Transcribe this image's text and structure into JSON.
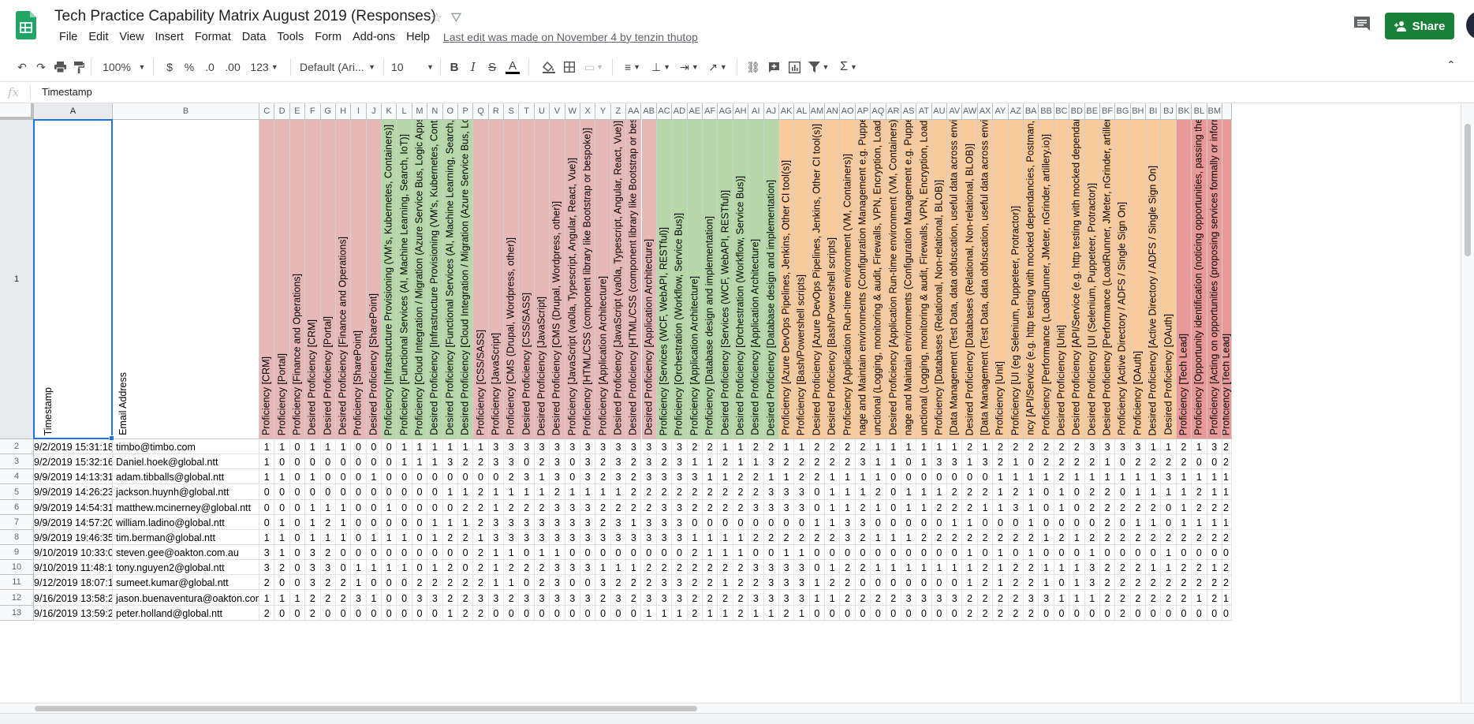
{
  "header": {
    "doc_title": "Tech Practice Capability Matrix August 2019 (Responses)",
    "last_edit": "Last edit was made on November 4 by tenzin thutop",
    "share_label": "Share",
    "menus": [
      "File",
      "Edit",
      "View",
      "Insert",
      "Format",
      "Data",
      "Tools",
      "Form",
      "Add-ons",
      "Help"
    ]
  },
  "toolbar": {
    "zoom": "100%",
    "currency": "$",
    "percent": "%",
    "dec_less": ".0",
    "dec_more": ".00",
    "more_formats": "123",
    "font": "Default (Ari...",
    "font_size": "10"
  },
  "formula_bar": {
    "fx": "fx",
    "value": "Timestamp"
  },
  "colors": {
    "red": "#e6b8b7",
    "green": "#b6d7a8",
    "orange": "#f9cb9c",
    "pink": "#ea9999",
    "accent": "#188038",
    "selection": "#1a73e8"
  },
  "sheet": {
    "columns": [
      {
        "letter": "A",
        "header": "Timestamp"
      },
      {
        "letter": "B",
        "header": "Email Address"
      },
      {
        "letter": "C",
        "header": "Proficiency [CRM]",
        "color": "red"
      },
      {
        "letter": "D",
        "header": "Proficiency [Portal]",
        "color": "red"
      },
      {
        "letter": "E",
        "header": "Proficiency [Finance and Operations]",
        "color": "red"
      },
      {
        "letter": "F",
        "header": "Desired  Proficiency [CRM]",
        "color": "red"
      },
      {
        "letter": "G",
        "header": "Desired  Proficiency [Portal]",
        "color": "red"
      },
      {
        "letter": "H",
        "header": "Desired  Proficiency [Finance and Operations]",
        "color": "red"
      },
      {
        "letter": "I",
        "header": "Proficiency [SharePoint]",
        "color": "red"
      },
      {
        "letter": "J",
        "header": "Desired  Proficiency [SharePoint]",
        "color": "red"
      },
      {
        "letter": "K",
        "header": "Proficiency [Infrastructure Provisioning (VM's, Kubernetes, Containers)]",
        "color": "green"
      },
      {
        "letter": "L",
        "header": "Proficiency [Functional Services (AI, Machine Learning, Search, IoT)]",
        "color": "green"
      },
      {
        "letter": "M",
        "header": "Proficiency [Cloud Integration / Migration (Azure Service Bus, Logic Apps)]",
        "color": "green"
      },
      {
        "letter": "N",
        "header": "Desired Proficiency [Infrastructure Provisioning (VM's, Kubernetes, Containers)]",
        "color": "green"
      },
      {
        "letter": "O",
        "header": "Desired Proficiency [Functional Services (AI, Machine Learning, Search, IoT)]",
        "color": "green"
      },
      {
        "letter": "P",
        "header": "Desired Proficiency [Cloud Integration / Migration (Azure Service Bus, Logic Apps)]",
        "color": "green"
      },
      {
        "letter": "Q",
        "header": "Proficiency [CSS/SASS]",
        "color": "red"
      },
      {
        "letter": "R",
        "header": "Proficiency [JavaScript]",
        "color": "red"
      },
      {
        "letter": "S",
        "header": "Proficiency [CMS (Drupal, Wordpress, other)]",
        "color": "red"
      },
      {
        "letter": "T",
        "header": "Desired  Proficiency [CSS/SASS]",
        "color": "red"
      },
      {
        "letter": "U",
        "header": "Desired  Proficiency [JavaScript]",
        "color": "red"
      },
      {
        "letter": "V",
        "header": "Desired  Proficiency [CMS (Drupal, Wordpress, other)]",
        "color": "red"
      },
      {
        "letter": "W",
        "header": "Proficiency [JavaScript (va0la, Typescript, Angular, React, Vue)]",
        "color": "red"
      },
      {
        "letter": "X",
        "header": "Proficiency [HTML/CSS (component library like Bootstrap or bespoke)]",
        "color": "red"
      },
      {
        "letter": "Y",
        "header": "Proficiency [Application Architecture]",
        "color": "red"
      },
      {
        "letter": "Z",
        "header": "Desired  Proficiency [JavaScript (va0la, Typescript, Angular, React, Vue)]",
        "color": "red"
      },
      {
        "letter": "AA",
        "header": "Desired  Proficiency [HTML/CSS (component library like Bootstrap or bespoke)]",
        "color": "red"
      },
      {
        "letter": "AB",
        "header": "Desired  Proficiency [Application Architecture]",
        "color": "red"
      },
      {
        "letter": "AC",
        "header": "Proficiency [Services (WCF, WebAPI, RESTful)]",
        "color": "green"
      },
      {
        "letter": "AD",
        "header": "Proficiency [Orchestration (Workflow, Service Bus)]",
        "color": "green"
      },
      {
        "letter": "AE",
        "header": "Proficiency [Application Architecture]",
        "color": "green"
      },
      {
        "letter": "AF",
        "header": "Proficiency [Database design and implementation]",
        "color": "green"
      },
      {
        "letter": "AG",
        "header": "Desired  Proficiency [Services (WCF, WebAPI, RESTful)]",
        "color": "green"
      },
      {
        "letter": "AH",
        "header": "Desired  Proficiency [Orchestration (Workflow, Service Bus)]",
        "color": "green"
      },
      {
        "letter": "AI",
        "header": "Desired  Proficiency [Application Architecture]",
        "color": "green"
      },
      {
        "letter": "AJ",
        "header": "Desired  Proficiency [Database design and implementation]",
        "color": "green"
      },
      {
        "letter": "AK",
        "header": "Proficiency [Azure DevOps Pipelines, Jenkins, Other CI tool(s)]",
        "color": "orange"
      },
      {
        "letter": "AL",
        "header": "Proficiency [Bash/Powershell scripts]",
        "color": "orange"
      },
      {
        "letter": "AM",
        "header": "Desired Proficiency [Azure DevOps Pipelines, Jenkins, Other CI tool(s)]",
        "color": "orange"
      },
      {
        "letter": "AN",
        "header": "Desired Proficiency [Bash/Powershell scripts]",
        "color": "orange"
      },
      {
        "letter": "AO",
        "header": "Proficiency [Application Run-time environment (VM, Containers)]",
        "color": "orange"
      },
      {
        "letter": "AP",
        "header": "nage and Maintain environments (Configuration Management e.g. Puppet, Ansible)]",
        "color": "orange"
      },
      {
        "letter": "AQ",
        "header": "unctional (Logging, monitoring & audit, Firewalls, VPN, Encryption, Load balancing)]",
        "color": "orange"
      },
      {
        "letter": "AR",
        "header": "Desired Proficiency [Application Run-time environment (VM, Containers)]",
        "color": "orange"
      },
      {
        "letter": "AS",
        "header": "nage and Maintain environments (Configuration Management e.g. Puppet, Ansible)]",
        "color": "orange"
      },
      {
        "letter": "AT",
        "header": "unctional (Logging, monitoring & audit, Firewalls, VPN, Encryption, Load balancing)]",
        "color": "orange"
      },
      {
        "letter": "AU",
        "header": "Proficiency [Databases  (Relational, Non-relational, BLOB)]",
        "color": "orange"
      },
      {
        "letter": "AV",
        "header": "[Data Management (Test Data, data obfuscation, useful data across environments)]",
        "color": "orange"
      },
      {
        "letter": "AW",
        "header": "Desired Proficiency [Databases  (Relational, Non-relational, BLOB)]",
        "color": "orange"
      },
      {
        "letter": "AX",
        "header": "[Data Management (Test Data, data obfuscation, useful data across environments)]",
        "color": "orange"
      },
      {
        "letter": "AY",
        "header": "Proficiency [Unit]",
        "color": "orange"
      },
      {
        "letter": "AZ",
        "header": "Proficiency [UI (eg Selenium, Puppeteer, Protractor)]",
        "color": "orange"
      },
      {
        "letter": "BA",
        "header": "ncy [API/Service (e.g. http testing with mocked dependancies, Postman, Insomnia)]",
        "color": "orange"
      },
      {
        "letter": "BB",
        "header": "Proficiency [Performance (LoadRunner, JMeter, nGrinder, artillery.io)]",
        "color": "orange"
      },
      {
        "letter": "BC",
        "header": "Desired Proficiency [Unit]",
        "color": "orange"
      },
      {
        "letter": "BD",
        "header": "Desired Proficiency [API/Service (e.g. http testing with mocked dependancies)]",
        "color": "orange"
      },
      {
        "letter": "BE",
        "header": "Desired Proficiency [UI (Selenium, Puppeteer, Protractor)]",
        "color": "orange"
      },
      {
        "letter": "BF",
        "header": "Desired Proficiency [Performance (LoadRunner, JMeter, nGrinder, artillery.io)]",
        "color": "orange"
      },
      {
        "letter": "BG",
        "header": "Proficiency [Active Directory / ADFS / Single Sign On]",
        "color": "orange"
      },
      {
        "letter": "BH",
        "header": "Proficiency [OAuth]",
        "color": "orange"
      },
      {
        "letter": "BI",
        "header": "Desired Proficiency [Active Directory / ADFS / Single Sign On]",
        "color": "orange"
      },
      {
        "letter": "BJ",
        "header": "Desired Proficiency [OAuth]",
        "color": "orange"
      },
      {
        "letter": "BK",
        "header": "Proficiency [Tech Lead]",
        "color": "pink"
      },
      {
        "letter": "BL",
        "header": "Proficiency [Opportunity identification (noticing opportunities, passing them on etc)]",
        "color": "pink"
      },
      {
        "letter": "BM",
        "header": "Proficiency [Acting on opportunities (proposing services formally or informally)]",
        "color": "pink"
      },
      {
        "letter": "",
        "header": "Proficiency [Tech Lead]",
        "color": "pink"
      }
    ],
    "rows": [
      {
        "n": "2",
        "ts": "9/2/2019 15:31:18",
        "email": "timbo@timbo.com",
        "v": "1 1 0 1 1 1 0 0 0 1 1 1 1 1 1 3 3 3 3 3 3 3 3 3 3 3 3 3 2 2 1 1 2 2 1 1 2 2 2 2 1 1 1 1 1 1 2 1 2 2 2 2 2 2 3 3 3 3 1 1 2 1 3 2 2 Ve"
      },
      {
        "n": "3",
        "ts": "9/2/2019 15:32:16",
        "email": "Daniel.hoek@global.ntt",
        "v": "1 0 0 0 0 0 0 0 0 1 1 1 3 2 2 3 3 0 2 3 0 3 2 3 2 3 2 3 1 1 2 1 1 3 2 2 2 2 2 3 1 1 0 1 3 3 1 3 2 1 0 2 2 2 2 1 0 2 2 2 2 0 0 2 1 2 2 Ve"
      },
      {
        "n": "4",
        "ts": "9/9/2019 14:13:31",
        "email": "adam.tibballs@global.ntt",
        "v": "1 1 0 1 0 0 0 1 0 0 0 0 0 0 0 0 2 3 1 3 0 3 2 3 2 3 3 3 3 1 1 2 2 1 1 2 2 1 1 1 1 0 0 0 0 0 0 0 1 1 1 1 2 1 1 1 1 1 1 3 1 1 1 1 1 1 1 2 So"
      },
      {
        "n": "5",
        "ts": "9/9/2019 14:26:23",
        "email": "jackson.huynh@global.ntt",
        "v": "0 0 0 0 0 0 0 0 0 0 0 0 1 1 2 1 1 1 1 2 1 1 1 1 2 2 2 2 2 2 2 2 2 3 3 3 0 1 1 1 2 0 1 1 1 2 2 2 1 2 1 0 1 0 2 2 0 1 1 1 1 2 1 1 1 0 0 So"
      },
      {
        "n": "6",
        "ts": "9/9/2019 14:54:31",
        "email": "matthew.mcinerney@global.ntt",
        "v": "0 0 0 1 1 1 0 0 1 0 0 0 0 2 2 1 2 2 2 3 3 3 2 2 2 2 3 3 2 2 2 2 3 3 3 3 0 1 1 2 1 0 1 1 2 2 2 1 1 3 1 0 1 0 2 2 2 2 2 0 1 2 2 2 2 2 2 So"
      },
      {
        "n": "7",
        "ts": "9/9/2019 14:57:20",
        "email": "william.ladino@global.ntt",
        "v": "0 1 0 1 2 1 0 0 0 0 0 1 1 1 2 3 3 3 3 3 3 3 2 3 1 3 3 3 0 0 0 0 0 0 0 0 1 1 3 3 0 0 0 0 0 1 1 0 0 0 1 0 0 0 0 2 0 1 1 0 1 1 1 1 1 1 1 Ve"
      },
      {
        "n": "8",
        "ts": "9/9/2019 19:46:35",
        "email": "tim.berman@global.ntt",
        "v": "1 1 0 1 1 1 0 1 1 1 0 1 2 2 1 3 3 3 3 3 3 3 3 3 3 3 3 3 1 1 1 1 2 2 2 2 2 2 3 2 1 1 1 2 2 2 2 2 2 2 2 1 2 1 2 2 2 2 2 2 2 2 2 2 2 2 Ve"
      },
      {
        "n": "9",
        "ts": "9/10/2019 10:33:06",
        "email": "steven.gee@oakton.com.au",
        "v": "3 1 0 3 2 0 0 0 0 0 0 0 0 0 2 1 1 0 1 1 0 0 0 0 0 0 0 0 2 1 1 1 0 0 1 1 0 0 0 0 0 0 0 0 0 0 1 0 1 0 1 0 0 0 1 0 0 0 0 1 0 0 0 0 1 1 0 Ve"
      },
      {
        "n": "10",
        "ts": "9/10/2019 11:48:11",
        "email": "tony.nguyen2@global.ntt",
        "v": "3 2 0 3 3 0 1 1 1 1 0 1 2 0 2 1 2 2 2 3 3 3 1 1 1 2 2 2 2 2 2 2 3 3 3 3 0 1 2 2 1 1 1 1 1 1 1 2 1 2 2 1 1 1 3 2 2 2 1 1 2 2 1 2 2 1 2 Ve"
      },
      {
        "n": "11",
        "ts": "9/12/2019 18:07:16",
        "email": "sumeet.kumar@global.ntt",
        "v": "2 0 0 3 2 2 1 0 0 0 2 2 2 2 2 1 1 0 2 3 0 0 3 2 2 2 3 3 2 2 1 2 2 3 3 3 1 2 2 0 0 0 0 0 0 0 1 2 1 2 2 1 0 1 3 2 2 2 2 2 2 2 2 2 2 2 2 Ve"
      },
      {
        "n": "12",
        "ts": "9/16/2019 13:58:28",
        "email": "jason.buenaventura@oakton.com.au",
        "v": "1 1 1 2 2 2 3 1 0 0 3 3 2 2 3 3 2 3 3 3 3 3 2 3 2 3 3 3 2 2 2 2 3 3 3 3 1 1 2 2 2 2 3 3 3 3 2 2 2 2 3 3 1 1 1 2 2 2 2 2 2 1 2 1 3 3 2 Ve"
      },
      {
        "n": "13",
        "ts": "9/16/2019 13:59:22",
        "email": "peter.holland@global.ntt",
        "v": "2 0 0 2 0 0 0 0 0 0 0 0 1 2 2 0 0 0 0 0 0 0 0 0 0 1 1 1 2 1 1 2 1 1 2 1 0 0 0 0 0 0 0 0 0 0 2 2 2 2 2 0 0 0 0 0 2 0 0 0 0 0 0 0 0 1 1 Ve"
      }
    ]
  }
}
